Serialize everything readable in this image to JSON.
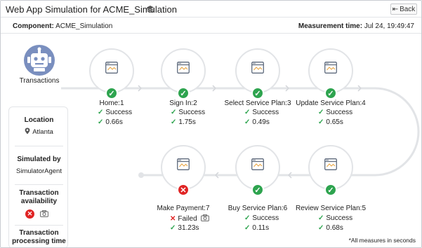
{
  "window": {
    "title": "Web App Simulation for ACME_Simulation",
    "back_label": "Back"
  },
  "info": {
    "component_label": "Component:",
    "component_value": "ACME_Simulation",
    "measurement_label": "Measurement time:",
    "measurement_value": "Jul 24, 19:49:47"
  },
  "start": {
    "label": "Transactions"
  },
  "steps": [
    {
      "label": "Home:1",
      "status": "Success",
      "time": "0.66s",
      "state": "ok"
    },
    {
      "label": "Sign In:2",
      "status": "Success",
      "time": "1.75s",
      "state": "ok"
    },
    {
      "label": "Select Service Plan:3",
      "status": "Success",
      "time": "0.49s",
      "state": "ok"
    },
    {
      "label": "Update Service Plan:4",
      "status": "Success",
      "time": "0.65s",
      "state": "ok"
    },
    {
      "label": "Review Service Plan:5",
      "status": "Success",
      "time": "0.68s",
      "state": "ok"
    },
    {
      "label": "Buy Service Plan:6",
      "status": "Success",
      "time": "0.11s",
      "state": "ok"
    },
    {
      "label": "Make Payment:7",
      "status": "Failed",
      "time": "31.23s",
      "state": "fail"
    }
  ],
  "panel": {
    "location_heading": "Location",
    "location_value": "Atlanta",
    "simulated_heading": "Simulated by",
    "simulated_value": "SimulatorAgent",
    "availability_heading": "Transaction availability",
    "processing_heading": "Transaction processing time"
  },
  "footnote": "*All measures in seconds",
  "colors": {
    "success": "#2ea44f",
    "failure": "#e02424",
    "robot": "#7a8fbf",
    "track": "#e2e4e7"
  }
}
